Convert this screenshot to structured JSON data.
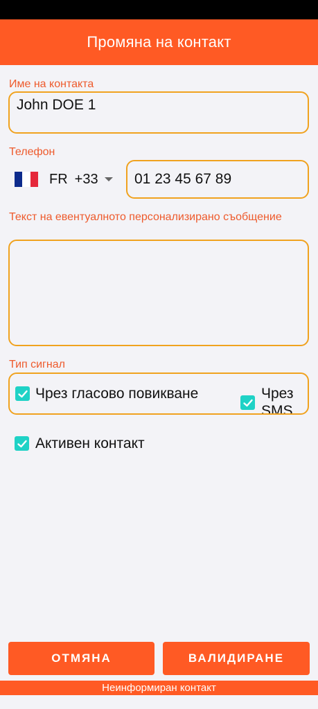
{
  "header": {
    "title": "Промяна на контакт"
  },
  "contact_name": {
    "label": "Име на контакта",
    "value": "John DOE 1"
  },
  "phone": {
    "label": "Телефон",
    "country_code": "FR",
    "dial_code": "+33",
    "value": "01 23 45 67 89",
    "flag_colors": [
      "#0d2b8c",
      "#ffffff",
      "#e5283b"
    ]
  },
  "message": {
    "label": "Текст на евентуалното персонализирано съобщение",
    "value": ""
  },
  "signal_type": {
    "label": "Тип сигнал",
    "voice_label": "Чрез гласово повикване",
    "voice_checked": true,
    "sms_label_line1": "Чрез",
    "sms_label_line2": "SMS",
    "sms_checked": true
  },
  "active": {
    "label": "Активен контакт",
    "checked": true
  },
  "buttons": {
    "cancel": "ОТМЯНА",
    "validate": "ВАЛИДИРАНЕ"
  },
  "footer": {
    "text": "Неинформиран контакт"
  },
  "colors": {
    "accent": "#ff5a24",
    "field_border": "#f0a21e",
    "label": "#ee5a2c",
    "checkbox": "#1fd2c6"
  }
}
